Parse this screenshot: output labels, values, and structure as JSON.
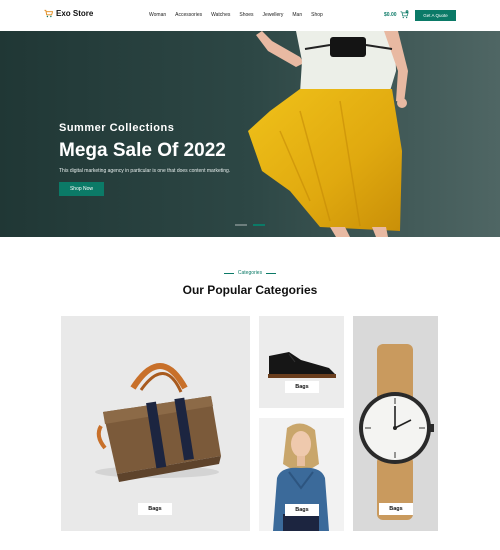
{
  "header": {
    "logo_text": "Exo Store",
    "nav": [
      "Woman",
      "Accessories",
      "Watches",
      "Shoes",
      "Jewellery",
      "Man",
      "Shop"
    ],
    "price": "$0.00",
    "cart_count": "0",
    "quote_label": "Get A Quote"
  },
  "hero": {
    "subtitle": "Summer Collections",
    "title": "Mega Sale Of 2022",
    "description": "This digital marketing agency in particular is one that does content marketing.",
    "button_label": "Shop Now"
  },
  "categories": {
    "eyebrow": "Categories",
    "title": "Our Popular Categories",
    "cards": [
      {
        "label": "Bags"
      },
      {
        "label": "Bags"
      },
      {
        "label": "Bags"
      },
      {
        "label": "Bags"
      }
    ]
  },
  "colors": {
    "accent": "#0b7a67",
    "hero_bg": "#2a4442"
  }
}
